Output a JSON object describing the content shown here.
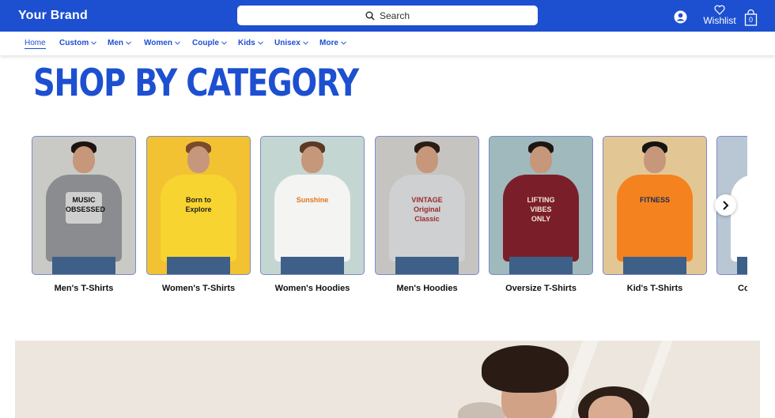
{
  "header": {
    "brand": "Your Brand",
    "search_label": "Search",
    "wishlist_label": "Wishlist",
    "cart_count": "0",
    "color": "#1d4fd1"
  },
  "nav": {
    "items": [
      {
        "label": "Home"
      },
      {
        "label": "Custom"
      },
      {
        "label": "Men"
      },
      {
        "label": "Women"
      },
      {
        "label": "Couple"
      },
      {
        "label": "Kids"
      },
      {
        "label": "Unisex"
      },
      {
        "label": "More"
      }
    ]
  },
  "section": {
    "title": "SHOP BY CATEGORY"
  },
  "categories": [
    {
      "label": "Men's T-Shirts",
      "print": "MUSIC OBSESSED",
      "bg": "#c9c9c6",
      "shirt": "#8a8c90",
      "hair": "#1d1410"
    },
    {
      "label": "Women's T-Shirts",
      "print": "Born to Explore",
      "bg": "#f2c232",
      "shirt": "#f8d430",
      "hair": "#7a4a2a"
    },
    {
      "label": "Women's Hoodies",
      "print": "Sunshine",
      "bg": "#c4d6d2",
      "shirt": "#f4f4f2",
      "hair": "#5a3a26"
    },
    {
      "label": "Men's Hoodies",
      "print": "VINTAGE Original Classic",
      "bg": "#c5c4c0",
      "shirt": "#cfd0d2",
      "hair": "#2b1d16"
    },
    {
      "label": "Oversize T-Shirts",
      "print": "LIFTING VIBES ONLY",
      "bg": "#9fb9bd",
      "shirt": "#7a1f2a",
      "hair": "#1e1612"
    },
    {
      "label": "Kid's T-Shirts",
      "print": "FITNESS",
      "bg": "#e2c795",
      "shirt": "#f4821f",
      "hair": "#141414"
    },
    {
      "label": "Co",
      "print": "",
      "bg": "#b9c7d4",
      "shirt": "#ffffff",
      "hair": "#3a2a20"
    }
  ],
  "icons": {
    "search": "search-icon",
    "user": "user-icon",
    "wishlist": "heart-icon",
    "cart": "shopping-bag-icon",
    "next": "chevron-right-icon"
  }
}
